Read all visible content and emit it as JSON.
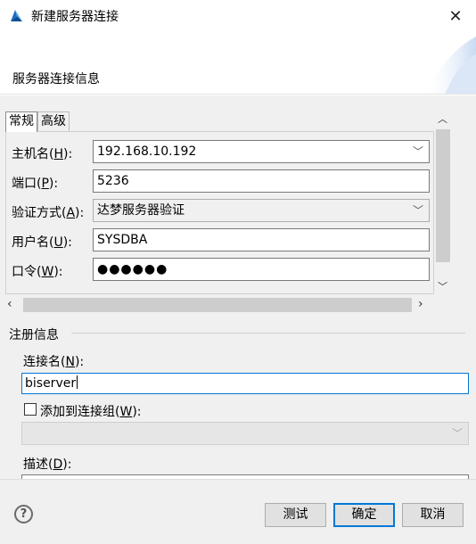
{
  "window": {
    "title": "新建服务器连接",
    "close_glyph": "✕"
  },
  "banner": {
    "title": "服务器连接信息"
  },
  "tabs": [
    {
      "label": "常规",
      "active": true
    },
    {
      "label": "高级",
      "active": false
    }
  ],
  "general": {
    "host": {
      "label": "主机名(",
      "mnemonic": "H",
      "label_end": "):",
      "value": "192.168.10.192"
    },
    "port": {
      "label": "端口(",
      "mnemonic": "P",
      "label_end": "):",
      "value": "5236"
    },
    "auth": {
      "label": "验证方式(",
      "mnemonic": "A",
      "label_end": "):",
      "value": "达梦服务器验证"
    },
    "user": {
      "label": "用户名(",
      "mnemonic": "U",
      "label_end": "):",
      "value": "SYSDBA"
    },
    "password": {
      "label": "口令(",
      "mnemonic": "W",
      "label_end": "):",
      "value": "●●●●●●"
    }
  },
  "register": {
    "group_title": "注册信息",
    "conn_name": {
      "label": "连接名(",
      "mnemonic": "N",
      "label_end": "):",
      "value": "biserver"
    },
    "add_to_group": {
      "label": "添加到连接组(",
      "mnemonic": "W",
      "label_end": "):",
      "checked": false
    },
    "desc": {
      "label": "描述(",
      "mnemonic": "D",
      "label_end": "):"
    }
  },
  "footer": {
    "help_glyph": "?",
    "test_label": "测试",
    "ok_label": "确定",
    "cancel_label": "取消"
  },
  "icons": {
    "app_icon": "app-logo-icon",
    "dropdown": "chevron-down-icon",
    "help": "help-icon"
  },
  "colors": {
    "accent": "#0078d7",
    "dialog_bg": "#f0f0f0"
  }
}
